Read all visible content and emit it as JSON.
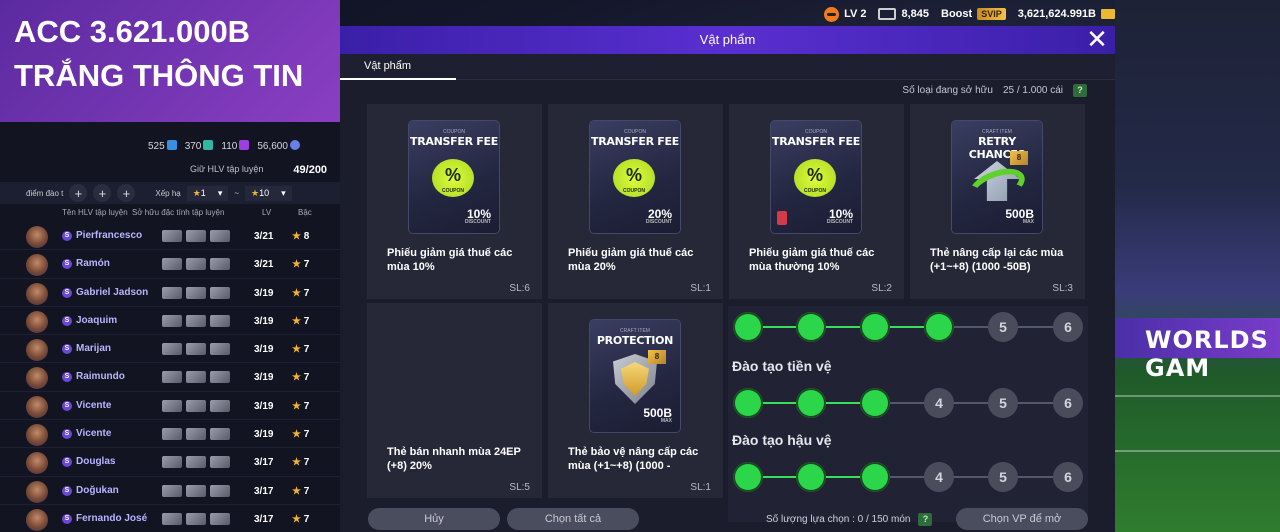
{
  "topbar": {
    "level": "LV 2",
    "rank_value": "8,845",
    "boost_label": "Boost",
    "svip_label": "SVIP",
    "coins": "3,621,624.991B"
  },
  "promo": {
    "line1": "ACC 3.621.000B",
    "line2": "TRẮNG THÔNG TIN"
  },
  "left_panel": {
    "currencies": [
      "525",
      "370",
      "110",
      "56,600"
    ],
    "trainer_label": "Giữ HLV tập luyện",
    "trainer_value": "49/200",
    "filter_label": "điểm đào t",
    "sort_label": "Xếp hạ",
    "sort_from": "1",
    "sort_dash": "~",
    "sort_to": "10",
    "headers": [
      "Tên HLV tập luyện",
      "Sở hữu đặc tính tập luyện",
      "LV",
      "Bậc"
    ],
    "players": [
      {
        "name": "Pierfrancesco",
        "lv": "3/21",
        "grade": "8"
      },
      {
        "name": "Ramón",
        "lv": "3/21",
        "grade": "7"
      },
      {
        "name": "Gabriel Jadson",
        "lv": "3/19",
        "grade": "7"
      },
      {
        "name": "Joaquim",
        "lv": "3/19",
        "grade": "7"
      },
      {
        "name": "Marijan",
        "lv": "3/19",
        "grade": "7"
      },
      {
        "name": "Raimundo",
        "lv": "3/19",
        "grade": "7"
      },
      {
        "name": "Vicente",
        "lv": "3/19",
        "grade": "7"
      },
      {
        "name": "Vicente",
        "lv": "3/19",
        "grade": "7"
      },
      {
        "name": "Douglas",
        "lv": "3/17",
        "grade": "7"
      },
      {
        "name": "Doğukan",
        "lv": "3/17",
        "grade": "7"
      },
      {
        "name": "Fernando José",
        "lv": "3/17",
        "grade": "7"
      }
    ]
  },
  "modal": {
    "title": "Vật phẩm",
    "tab": "Vật phẩm",
    "owned_label": "Số loại đang sở hữu",
    "owned_value": "25 / 1.000 cái",
    "help": "?",
    "items": [
      {
        "kicker": "COUPON",
        "title": "TRANSFER FEE",
        "pct": "10%",
        "pct_sub": "DISCOUNT",
        "desc": "Phiếu giảm giá thuế các mùa 10%",
        "qty": "SL:6"
      },
      {
        "kicker": "COUPON",
        "title": "TRANSFER FEE",
        "pct": "20%",
        "pct_sub": "DISCOUNT",
        "desc": "Phiếu giảm giá thuế các mùa 20%",
        "qty": "SL:1"
      },
      {
        "kicker": "COUPON",
        "title": "TRANSFER FEE",
        "pct": "10%",
        "pct_sub": "DISCOUNT",
        "desc": "Phiếu giảm giá thuế các mùa thường 10%",
        "qty": "SL:2"
      },
      {
        "kicker": "CRAFT ITEM",
        "title": "RETRY CHANCES",
        "pct": "500B",
        "pct_sub": "MAX",
        "desc": "Thẻ nâng cấp lại các mùa (+1~+8) (1000 -50B)",
        "qty": "SL:3"
      },
      {
        "kicker": "",
        "title": "",
        "pct": "",
        "pct_sub": "",
        "desc": "Thẻ bán nhanh mùa 24EP (+8) 20%",
        "qty": "SL:5"
      },
      {
        "kicker": "CRAFT ITEM",
        "title": "PROTECTION",
        "pct": "500B",
        "pct_sub": "MAX",
        "desc": "Thẻ bảo vệ nâng cấp các mùa (+1~+8) (1000 -",
        "qty": "SL:1"
      }
    ],
    "coupon_sign": "%",
    "coupon_sub": "COUPON",
    "gold_badge": "8",
    "training": {
      "midfield_title": "Đào tạo tiền vệ",
      "defense_title": "Đào tạo hậu vệ",
      "track1": [
        "",
        "",
        "",
        "",
        "5",
        "6"
      ],
      "track2": [
        "",
        "",
        "",
        "4",
        "5",
        "6"
      ],
      "track3": [
        "",
        "",
        "",
        "4",
        "5",
        "6"
      ]
    },
    "bottom": {
      "cancel": "Hủy",
      "select_all": "Chọn tất cả",
      "count_label": "Số lượng lựa chọn : 0 / 150 món",
      "help": "?",
      "choose": "Chọn VP để mở"
    }
  },
  "background": {
    "ad_text": "WORLDS GAM"
  },
  "colors": {
    "accent_purple": "#5a2fd0",
    "node_green": "#2bd64a",
    "coupon_lime": "#dffb3e",
    "star_gold": "#f2b233"
  }
}
